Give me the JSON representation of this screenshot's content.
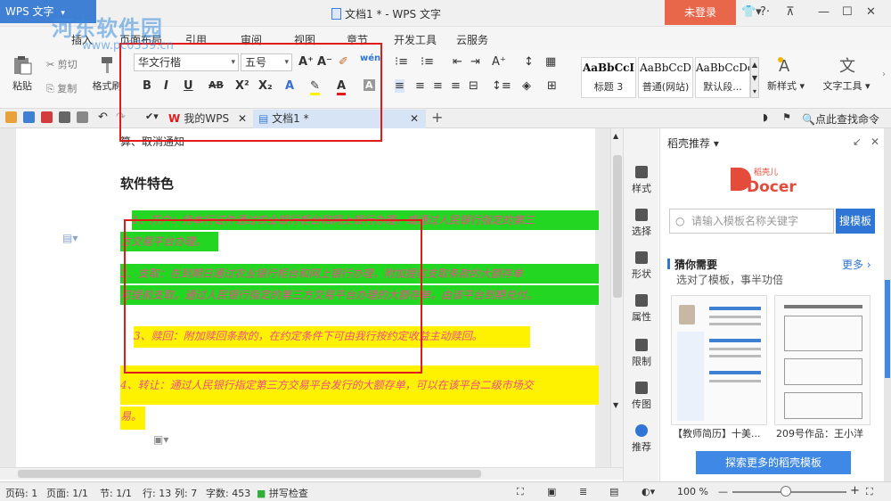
{
  "window": {
    "app_badge": "WPS 文字",
    "title": "文档1 * - WPS 文字",
    "login_button": "未登录",
    "skin_icon": "shirt-icon",
    "help_icon": "question-icon"
  },
  "menu": {
    "tabs": [
      "插入",
      "页面布局",
      "引用",
      "审阅",
      "视图",
      "章节",
      "开发工具",
      "云服务"
    ]
  },
  "ribbon": {
    "paste_label": "粘贴",
    "cut_label": "剪切",
    "copy_label": "复制",
    "format_painter_label": "格式刷",
    "font_name": "华文行楷",
    "font_size": "五号",
    "styles": [
      {
        "sample": "AaBbCcI",
        "name": "标题 3"
      },
      {
        "sample": "AaBbCcD",
        "name": "普通(网站)"
      },
      {
        "sample": "AaBbCcDc",
        "name": "默认段..."
      }
    ],
    "new_style_label": "新样式",
    "text_tools_label": "文字工具",
    "highlight_color": "#fff200",
    "font_color": "#e11b1b"
  },
  "tabs_bar": {
    "tabs": [
      "我的WPS",
      "文档1 *"
    ],
    "command_search": "点此查找命令"
  },
  "document": {
    "cancel_text": "算、取消通知",
    "heading": "软件特色",
    "paragraphs": [
      {
        "line1": "1、开户：持本行证件通过农业银行柜台和网上银行办理，或通过人民银行指定的第三",
        "line2": "方交易平台办理。",
        "color": "#22d622"
      },
      {
        "line1": "2、支取：在到期日通过农业银行柜台和网上银行办理，附加提前支取条款的大额存单",
        "line2": "可提前支取。通过人民银行指定的第三方交易平台办理的大额存单，由该平台到期兑付。",
        "color": "#22d622"
      },
      {
        "line1": "3、赎回：附加赎回条款的，在约定条件下可由我行按约定收益主动赎回。",
        "line2": "",
        "color": "#fff200"
      },
      {
        "line1": "4、转让：通过人民银行指定第三方交易平台发行的大额存单，可以在该平台二级市场交",
        "line2": "易。",
        "color": "#fff200"
      }
    ]
  },
  "side_tools": [
    "样式",
    "选择",
    "形状",
    "属性",
    "限制",
    "传图",
    "推荐"
  ],
  "panel": {
    "title": "稻壳推荐",
    "logo_top": "稻壳儿",
    "logo_word": "Docer",
    "search_placeholder": "请输入模板名称关键字",
    "search_button": "搜模板",
    "guess_title": "猜你需要",
    "guess_more": "更多",
    "guess_sub": "选对了模板，事半功倍",
    "thumbs": [
      "【教师简历】十美...",
      "209号作品：王小洋"
    ],
    "explore_button": "探索更多的稻壳模板"
  },
  "status": {
    "page_no": "页码: 1",
    "pages": "页面: 1/1",
    "section": "节: 1/1",
    "row": "行: 13",
    "col": "列: 7",
    "words": "字数: 453",
    "spell": "拼写检查",
    "zoom": "100 %"
  },
  "watermark": {
    "text": "河东软件园",
    "url": "www.pc0359.cn"
  }
}
